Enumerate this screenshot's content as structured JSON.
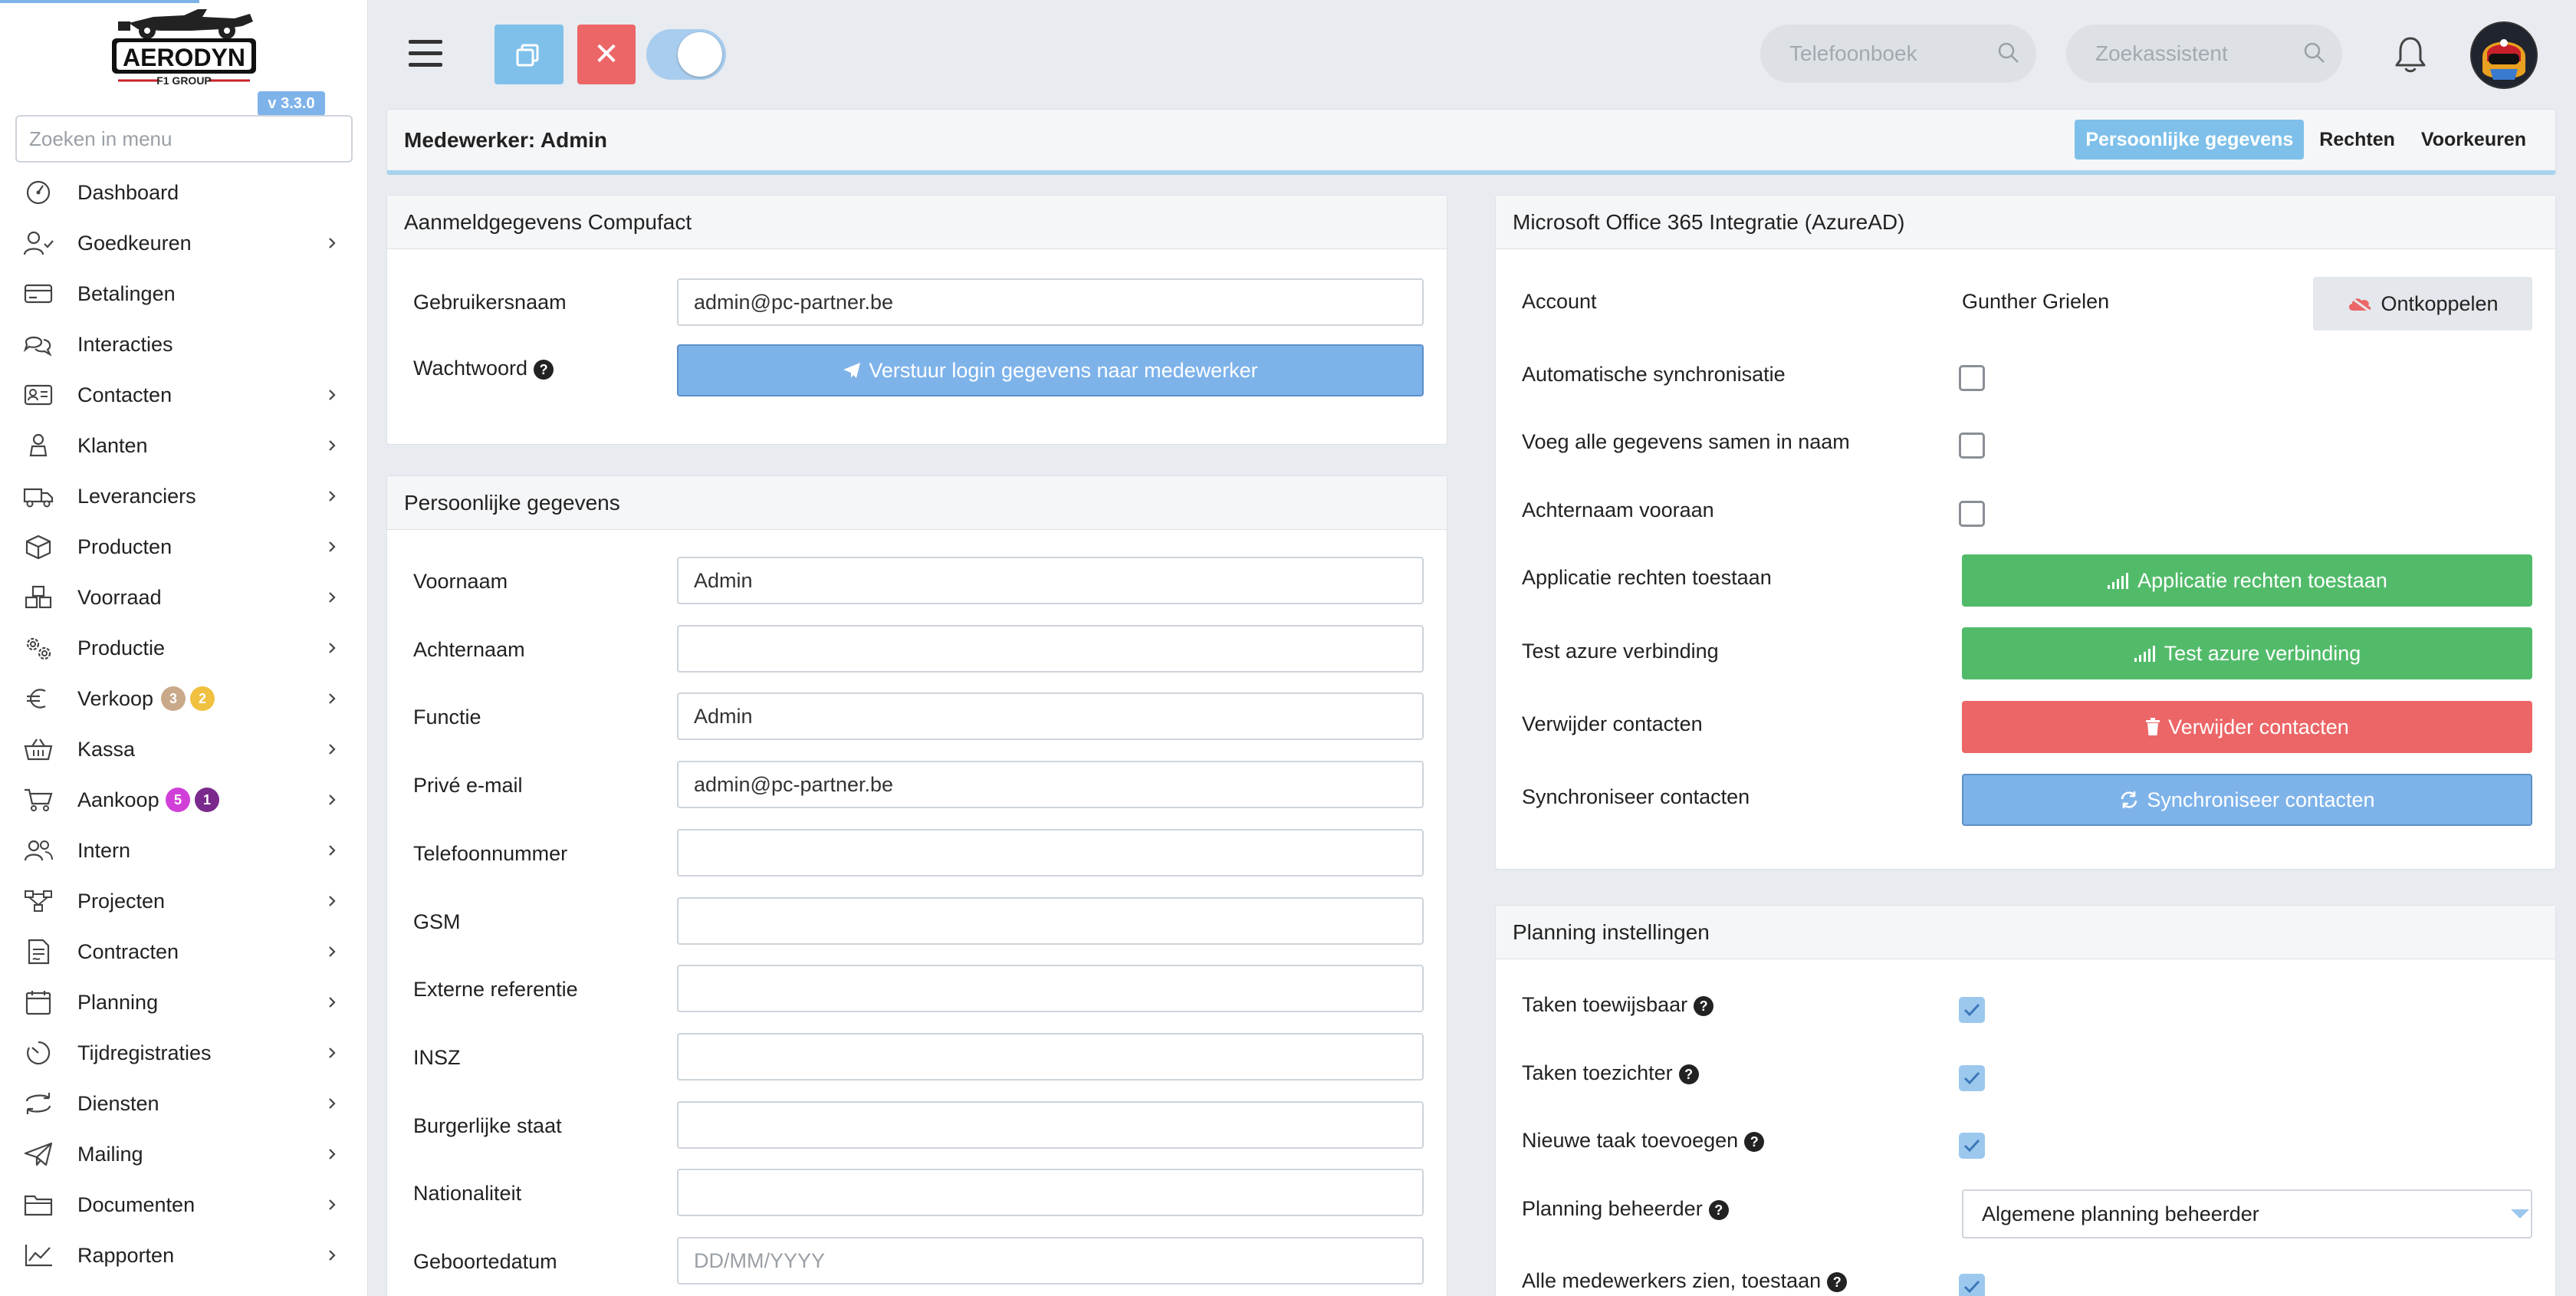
{
  "brand": {
    "name": "AERODYN",
    "subtitle": "F1 GROUP",
    "version": "v 3.3.0"
  },
  "sidebar": {
    "search_placeholder": "Zoeken in menu",
    "items": [
      {
        "label": "Dashboard",
        "icon": "dashboard-icon",
        "chevron": false
      },
      {
        "label": "Goedkeuren",
        "icon": "user-check-icon",
        "chevron": true
      },
      {
        "label": "Betalingen",
        "icon": "credit-card-icon",
        "chevron": false
      },
      {
        "label": "Interacties",
        "icon": "chat-icon",
        "chevron": false
      },
      {
        "label": "Contacten",
        "icon": "contact-card-icon",
        "chevron": true
      },
      {
        "label": "Klanten",
        "icon": "customer-icon",
        "chevron": true
      },
      {
        "label": "Leveranciers",
        "icon": "truck-icon",
        "chevron": true
      },
      {
        "label": "Producten",
        "icon": "box-icon",
        "chevron": true
      },
      {
        "label": "Voorraad",
        "icon": "boxes-icon",
        "chevron": true
      },
      {
        "label": "Productie",
        "icon": "gears-icon",
        "chevron": true
      },
      {
        "label": "Verkoop",
        "icon": "euro-icon",
        "chevron": true
      },
      {
        "label": "Kassa",
        "icon": "basket-icon",
        "chevron": true
      },
      {
        "label": "Aankoop",
        "icon": "cart-icon",
        "chevron": true
      },
      {
        "label": "Intern",
        "icon": "users-icon",
        "chevron": true
      },
      {
        "label": "Projecten",
        "icon": "diagram-icon",
        "chevron": true
      },
      {
        "label": "Contracten",
        "icon": "contract-icon",
        "chevron": true
      },
      {
        "label": "Planning",
        "icon": "calendar-icon",
        "chevron": true
      },
      {
        "label": "Tijdregistraties",
        "icon": "timer-icon",
        "chevron": true
      },
      {
        "label": "Diensten",
        "icon": "exchange-icon",
        "chevron": true
      },
      {
        "label": "Mailing",
        "icon": "paper-plane-icon",
        "chevron": true
      },
      {
        "label": "Documenten",
        "icon": "folder-icon",
        "chevron": true
      },
      {
        "label": "Rapporten",
        "icon": "line-chart-icon",
        "chevron": true
      }
    ],
    "verkoop_badges": [
      {
        "count": "3",
        "color": "#c9a98a"
      },
      {
        "count": "2",
        "color": "#f0c040"
      }
    ],
    "aankoop_badges": [
      {
        "count": "5",
        "color": "#d040d8"
      },
      {
        "count": "1",
        "color": "#7a2a8c"
      }
    ]
  },
  "topbar": {
    "phonebook_placeholder": "Telefoonboek",
    "assistant_placeholder": "Zoekassistent"
  },
  "header": {
    "title": "Medewerker: Admin",
    "tabs": [
      {
        "label": "Persoonlijke gegevens",
        "active": true
      },
      {
        "label": "Rechten",
        "active": false
      },
      {
        "label": "Voorkeuren",
        "active": false
      }
    ]
  },
  "login_card": {
    "title": "Aanmeldgegevens Compufact",
    "username_label": "Gebruikersnaam",
    "username_value": "admin@pc-partner.be",
    "password_label": "Wachtwoord",
    "send_button": "Verstuur login gegevens naar medewerker"
  },
  "personal_card": {
    "title": "Persoonlijke gegevens",
    "fields": [
      {
        "label": "Voornaam",
        "value": "Admin",
        "placeholder": ""
      },
      {
        "label": "Achternaam",
        "value": "",
        "placeholder": ""
      },
      {
        "label": "Functie",
        "value": "Admin",
        "placeholder": ""
      },
      {
        "label": "Privé e-mail",
        "value": "admin@pc-partner.be",
        "placeholder": ""
      },
      {
        "label": "Telefoonnummer",
        "value": "",
        "placeholder": ""
      },
      {
        "label": "GSM",
        "value": "",
        "placeholder": ""
      },
      {
        "label": "Externe referentie",
        "value": "",
        "placeholder": ""
      },
      {
        "label": "INSZ",
        "value": "",
        "placeholder": ""
      },
      {
        "label": "Burgerlijke staat",
        "value": "",
        "placeholder": ""
      },
      {
        "label": "Nationaliteit",
        "value": "",
        "placeholder": ""
      },
      {
        "label": "Geboortedatum",
        "value": "",
        "placeholder": "DD/MM/YYYY"
      }
    ]
  },
  "azure_card": {
    "title": "Microsoft Office 365 Integratie (AzureAD)",
    "account_label": "Account",
    "account_value": "Gunther Grielen",
    "disconnect_button": "Ontkoppelen",
    "auto_sync_label": "Automatische synchronisatie",
    "merge_label": "Voeg alle gegevens samen in naam",
    "lastname_first_label": "Achternaam vooraan",
    "app_rights_label": "Applicatie rechten toestaan",
    "app_rights_button": "Applicatie rechten toestaan",
    "test_label": "Test azure verbinding",
    "test_button": "Test azure verbinding",
    "delete_label": "Verwijder contacten",
    "delete_button": "Verwijder contacten",
    "sync_label": "Synchroniseer contacten",
    "sync_button": "Synchroniseer contacten"
  },
  "planning_card": {
    "title": "Planning instellingen",
    "assignable_label": "Taken toewijsbaar",
    "supervisor_label": "Taken toezichter",
    "new_task_label": "Nieuwe taak toevoegen",
    "manager_label": "Planning beheerder",
    "manager_value": "Algemene planning beheerder",
    "see_all_label": "Alle medewerkers zien, toestaan"
  }
}
